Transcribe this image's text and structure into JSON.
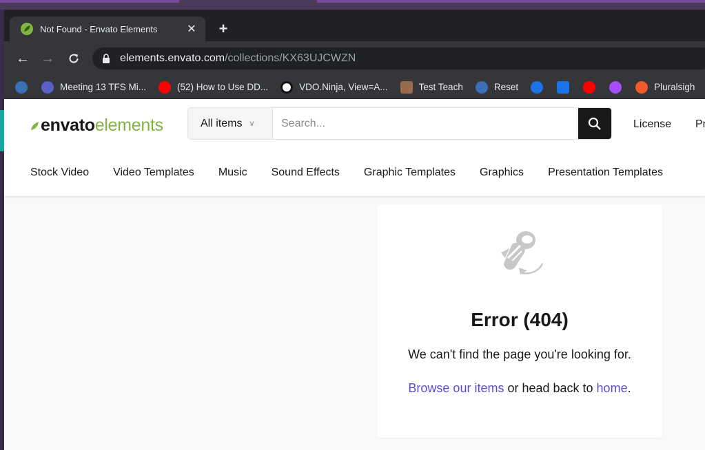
{
  "browser": {
    "tab": {
      "title": "Not Found - Envato Elements",
      "close": "✕"
    },
    "new_tab": "+",
    "nav": {
      "back": "←",
      "forward": "→",
      "reload": "C"
    },
    "url": {
      "host": "elements.envato.com",
      "path": "/collections/KX63UJCWZN"
    },
    "bookmarks": [
      {
        "label": "",
        "icon": "wordpress-icon",
        "color": "#3b6fb6"
      },
      {
        "label": "Meeting 13 TFS Mi...",
        "icon": "teams-icon",
        "color": "#5b5fc7"
      },
      {
        "label": "(52) How to Use DD...",
        "icon": "youtube-icon",
        "color": "#ff0000"
      },
      {
        "label": "VDO.Ninja, View=A...",
        "icon": "vdo-ninja-icon",
        "color": "#ffffff"
      },
      {
        "label": "Test Teach",
        "icon": "avatar-icon",
        "color": "#9a6b4a"
      },
      {
        "label": "Reset",
        "icon": "wordpress-icon",
        "color": "#3b6fb6"
      },
      {
        "label": "",
        "icon": "circle-blue-icon",
        "color": "#1a73e8"
      },
      {
        "label": "",
        "icon": "calendar-icon",
        "color": "#1a73e8"
      },
      {
        "label": "",
        "icon": "youtube-icon",
        "color": "#ff0000"
      },
      {
        "label": "",
        "icon": "gradient-circle-icon",
        "color": "#a64dff"
      },
      {
        "label": "Pluralsigh",
        "icon": "pluralsight-icon",
        "color": "#f15b2a"
      }
    ]
  },
  "site": {
    "logo": {
      "part1": "envato",
      "part2": "elements"
    },
    "search": {
      "category": "All items",
      "placeholder": "Search..."
    },
    "links": {
      "license": "License",
      "pricing": "Pr"
    },
    "categories": [
      "Stock Video",
      "Video Templates",
      "Music",
      "Sound Effects",
      "Graphic Templates",
      "Graphics",
      "Presentation Templates"
    ],
    "colors": {
      "brand_green": "#82b541",
      "link": "#5b4dd1",
      "dark": "#191919"
    }
  },
  "error": {
    "title": "Error (404)",
    "message": "We can't find the page you're looking for.",
    "browse_link": "Browse our items",
    "middle": " or head back to ",
    "home_link": "home",
    "end": "."
  }
}
